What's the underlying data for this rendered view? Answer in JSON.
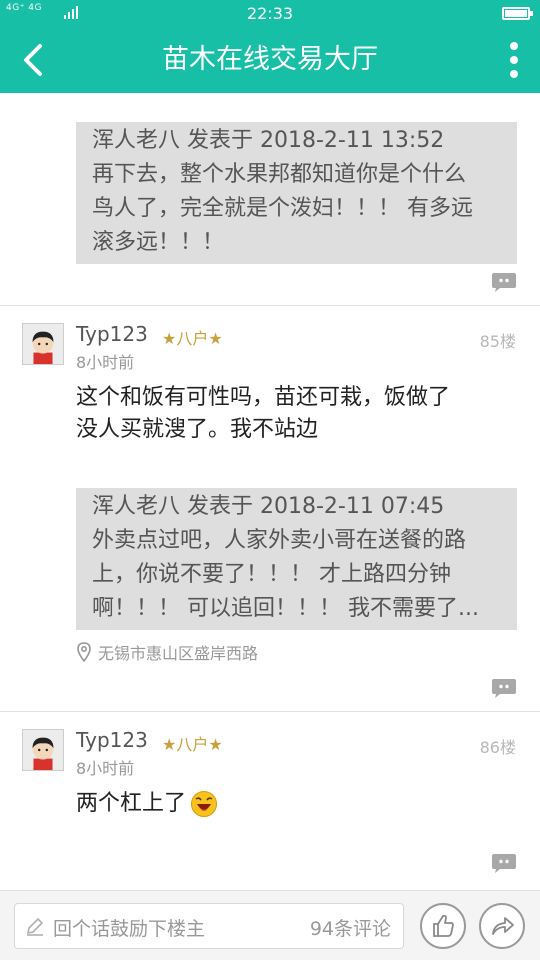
{
  "status_bar": {
    "network": "4G⁺ 4G",
    "time": "22:33"
  },
  "header": {
    "title": "苗木在线交易大厅"
  },
  "quote_top": {
    "text": "浑人老八 发表于 2018-2-11 13:52\n再下去，整个水果邦都知道你是个什么\n鸟人了，完全就是个泼妇！！！ 有多远\n滚多远！！！"
  },
  "posts": [
    {
      "username": "Typ123",
      "rank": "★八户★",
      "time": "8小时前",
      "floor": "85楼",
      "body": "这个和饭有可性吗，苗还可栽，饭做了\n没人买就溲了。我不站边",
      "quote": "浑人老八 发表于 2018-2-11 07:45\n外卖点过吧，人家外卖小哥在送餐的路\n上，你说不要了！！！ 才上路四分钟\n啊！！！ 可以追回！！！ 我不需要了...",
      "location": "无锡市惠山区盛岸西路"
    },
    {
      "username": "Typ123",
      "rank": "★八户★",
      "time": "8小时前",
      "floor": "86楼",
      "body": "两个杠上了"
    }
  ],
  "bottom_bar": {
    "input_placeholder": "回个话鼓励下楼主",
    "comment_count": "94条评论"
  },
  "icons": {
    "back": "chevron-left-icon",
    "more": "more-vertical-icon",
    "comment": "comment-bubble-icon",
    "location": "location-pin-icon",
    "like": "thumbs-up-icon",
    "share": "share-arrow-icon",
    "edit": "pencil-icon",
    "emoji": "laughing-emoji-icon"
  },
  "colors": {
    "brand": "#16bfa5",
    "rank": "#c9a13a",
    "quote_bg": "#dedede"
  }
}
